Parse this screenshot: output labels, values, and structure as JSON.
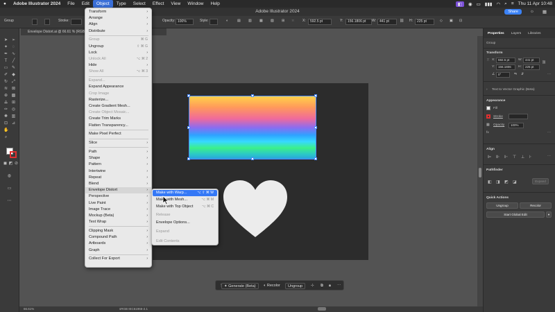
{
  "menubar": {
    "apple": "",
    "app": "Adobe Illustrator 2024",
    "items": [
      "File",
      "Edit",
      "Object",
      "Type",
      "Select",
      "Effect",
      "View",
      "Window",
      "Help"
    ],
    "clock": "Thu 11 Apr 10:48"
  },
  "window": {
    "title": "Adobe Illustrator 2024",
    "share": "Share"
  },
  "controlbar": {
    "group": "Group",
    "stroke": "Stroke:",
    "opacity_label": "Opacity:",
    "opacity_value": "100%",
    "style_label": "Style:",
    "x_label": "X:",
    "x_value": "592.5 pt",
    "y_label": "Y:",
    "y_value": "156.1806 pt",
    "w_label": "W:",
    "w_value": "441 pt",
    "h_label": "H:",
    "h_value": "225 pt"
  },
  "doc_tab": "Envelope Distort.ai @ 66.61 % (RGB/P...",
  "object_menu": {
    "items": [
      {
        "label": "Transform",
        "arrow": true
      },
      {
        "label": "Arrange",
        "arrow": true
      },
      {
        "label": "Align",
        "arrow": true
      },
      {
        "label": "Distribute",
        "arrow": true
      },
      {
        "sep": true
      },
      {
        "label": "Group",
        "shortcut": "⌘ G",
        "disabled": true
      },
      {
        "label": "Ungroup",
        "shortcut": "⇧ ⌘ G"
      },
      {
        "label": "Lock",
        "arrow": true
      },
      {
        "label": "Unlock All",
        "shortcut": "⌥ ⌘ 2",
        "disabled": true
      },
      {
        "label": "Hide",
        "arrow": true
      },
      {
        "label": "Show All",
        "shortcut": "⌥ ⌘ 3",
        "disabled": true
      },
      {
        "sep": true
      },
      {
        "label": "Expand...",
        "disabled": true
      },
      {
        "label": "Expand Appearance"
      },
      {
        "label": "Crop Image",
        "disabled": true
      },
      {
        "label": "Rasterize..."
      },
      {
        "label": "Create Gradient Mesh..."
      },
      {
        "label": "Create Object Mosaic...",
        "disabled": true
      },
      {
        "label": "Create Trim Marks"
      },
      {
        "label": "Flatten Transparency..."
      },
      {
        "sep": true
      },
      {
        "label": "Make Pixel Perfect"
      },
      {
        "sep": true
      },
      {
        "label": "Slice",
        "arrow": true
      },
      {
        "sep": true
      },
      {
        "label": "Path",
        "arrow": true
      },
      {
        "label": "Shape",
        "arrow": true
      },
      {
        "label": "Pattern",
        "arrow": true
      },
      {
        "label": "Intertwine",
        "arrow": true
      },
      {
        "label": "Repeat",
        "arrow": true
      },
      {
        "label": "Blend",
        "arrow": true
      },
      {
        "label": "Envelope Distort",
        "arrow": true,
        "highlight": true
      },
      {
        "label": "Perspective",
        "arrow": true
      },
      {
        "label": "Live Paint",
        "arrow": true
      },
      {
        "label": "Image Trace",
        "arrow": true
      },
      {
        "label": "Mockup (Beta)",
        "arrow": true
      },
      {
        "label": "Text Wrap",
        "arrow": true
      },
      {
        "sep": true
      },
      {
        "label": "Clipping Mask",
        "arrow": true
      },
      {
        "label": "Compound Path",
        "arrow": true
      },
      {
        "label": "Artboards",
        "arrow": true
      },
      {
        "label": "Graph",
        "arrow": true
      },
      {
        "sep": true
      },
      {
        "label": "Collect For Export",
        "arrow": true
      }
    ]
  },
  "envelope_submenu": {
    "items": [
      {
        "label": "Make with Warp...",
        "shortcut": "⌥ ⇧ ⌘ W",
        "selected": true
      },
      {
        "label": "Make with Mesh...",
        "shortcut": "⌥ ⌘ M"
      },
      {
        "label": "Make with Top Object",
        "shortcut": "⌥ ⌘ C"
      },
      {
        "label": "Release",
        "disabled": true
      },
      {
        "label": "Envelope Options..."
      },
      {
        "label": "Expand",
        "disabled": true
      },
      {
        "label": "Edit Contents",
        "disabled": true
      }
    ]
  },
  "taskbar": {
    "generate": "Generate (Beta)",
    "recolor": "Recolor",
    "ungroup": "Ungroup"
  },
  "status": {
    "zoom": "66.61%",
    "color_mode": "sRGB IEC61966-2.1"
  },
  "panel": {
    "tabs": [
      "Properties",
      "Layers",
      "Libraries"
    ],
    "selection": "Group",
    "transform_title": "Transform",
    "x_label": "X:",
    "x_value": "592.5 pt",
    "y_label": "Y:",
    "y_value": "156.1806",
    "w_label": "W:",
    "w_value": "441 pt",
    "h_label": "H:",
    "h_value": "225 pt",
    "angle_value": "0°",
    "vector_graphic": "Text to Vector Graphic (Beta)",
    "appearance_title": "Appearance",
    "fill_label": "Fill",
    "stroke_label": "Stroke",
    "opacity_label": "Opacity",
    "opacity_value": "100%",
    "align_title": "Align",
    "pathfinder_title": "Pathfinder",
    "expand_label": "Expand",
    "quick_actions_title": "Quick Actions",
    "ungroup_btn": "Ungroup",
    "recolor_btn": "Recolor",
    "global_edit_btn": "Start Global Edit"
  }
}
